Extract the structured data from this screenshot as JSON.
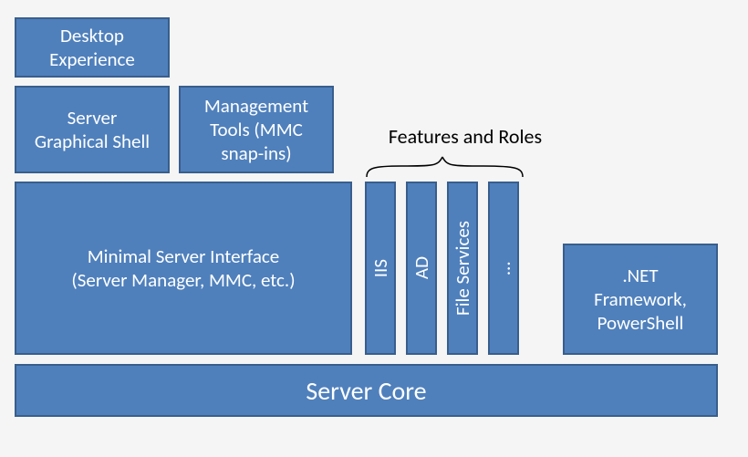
{
  "blocks": {
    "desktop_experience": "Desktop\nExperience",
    "server_graphical_shell": "Server\nGraphical Shell",
    "management_tools": "Management\nTools (MMC\nsnap-ins)",
    "minimal_server_interface": "Minimal Server Interface\n(Server Manager, MMC, etc.)",
    "iis": "IIS",
    "ad": "AD",
    "file_services": "File Services",
    "more": "…",
    "dotnet": ".NET\nFramework,\nPowerShell",
    "server_core": "Server Core"
  },
  "label": {
    "features_and_roles": "Features and Roles"
  },
  "colors": {
    "box_fill": "#4f80bc",
    "box_border": "#385e8c",
    "background": "#f5f5f5"
  },
  "diagram_structure": {
    "base": "server_core",
    "left_stack_bottom_to_top": [
      "minimal_server_interface",
      [
        "server_graphical_shell",
        "management_tools"
      ],
      "desktop_experience"
    ],
    "features_and_roles": [
      "iis",
      "ad",
      "file_services",
      "more"
    ],
    "right": "dotnet"
  }
}
